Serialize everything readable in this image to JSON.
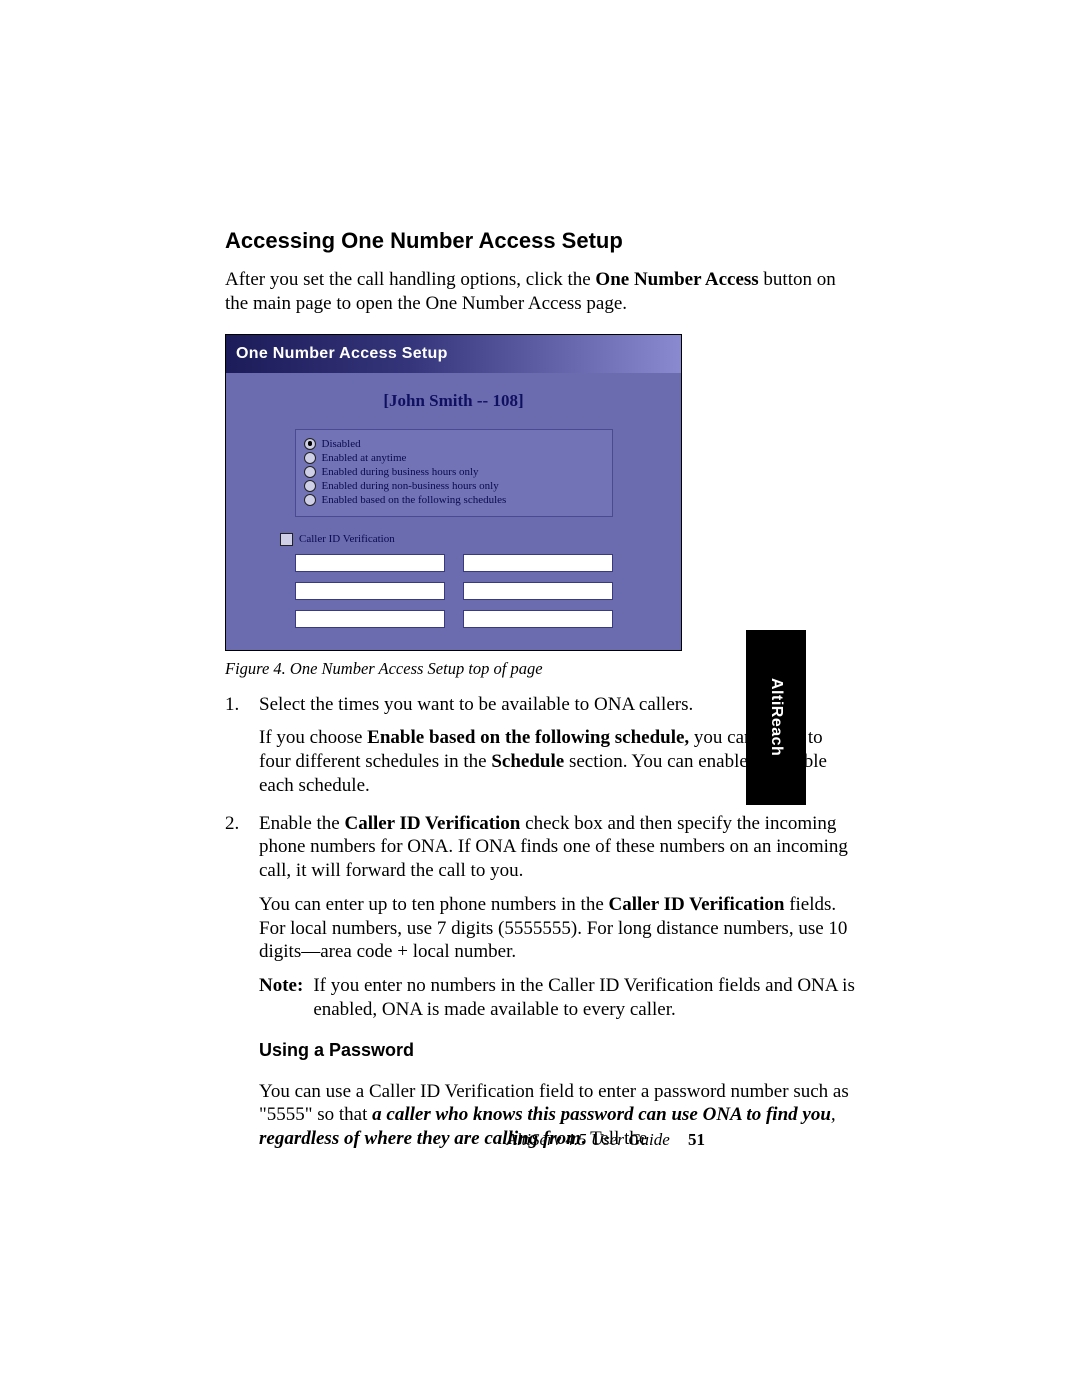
{
  "heading": "Accessing One Number Access Setup",
  "intro_pre": "After you set the call handling options, click the ",
  "intro_bold": "One Number Access",
  "intro_post": " button on the main page to open the One Number Access page.",
  "screenshot": {
    "banner": "One Number Access Setup",
    "user": "[John Smith -- 108]",
    "options": [
      "Disabled",
      "Enabled at anytime",
      "Enabled during business hours only",
      "Enabled during non-business hours only",
      "Enabled based on the following schedules"
    ],
    "caller_id_label": "Caller ID Verification"
  },
  "caption": "Figure 4.    One Number Access Setup top of page",
  "step1_text": "Select the times you want to be available to ONA callers.",
  "step1_p2_a": "If you choose ",
  "step1_p2_b": "Enable based on the following schedule,",
  "step1_p2_c": " you can set up to four different schedules in the ",
  "step1_p2_d": "Schedule",
  "step1_p2_e": " section. You can enable or disable each schedule.",
  "step2_a": "Enable the ",
  "step2_b": "Caller ID Verification",
  "step2_c": " check box and then specify the incoming phone numbers for ONA. If ONA finds one of these numbers on an incoming call, it will forward the call to you.",
  "step2_p2_a": "You can enter up to ten phone numbers in the ",
  "step2_p2_b": "Caller ID Verification",
  "step2_p2_c": " fields. For local numbers, use 7 digits (5555555). For long distance numbers, use 10 digits—area code + local number.",
  "note_label": "Note:",
  "note_text": "If you enter no numbers in the Caller ID Verification fields and ONA is enabled, ONA is made available to every caller.",
  "subhead": "Using a Password",
  "sub_a": "You can use a Caller ID Verification field to enter a password number such as \"5555\" so that ",
  "sub_b": "a caller who knows this password can use ONA to find you",
  "sub_c": ", ",
  "sub_d": "regardless of where they are calling from",
  "sub_e": ".",
  "sub_f": " Tell the",
  "side_tab": "AltiReach",
  "footer_guide": "AltiServ 4.5 User Guide",
  "footer_page": "51"
}
